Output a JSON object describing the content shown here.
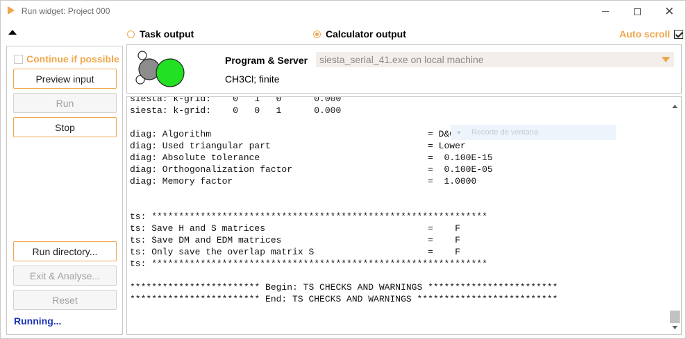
{
  "window": {
    "title": "Run widget: Project 000",
    "minimize_label": "",
    "maximize_label": "",
    "close_label": "✕"
  },
  "left_panel": {
    "continue_checkbox_label": "Continue if possible",
    "continue_checked": false,
    "buttons": [
      {
        "label": "Preview input",
        "enabled": true
      },
      {
        "label": "Run",
        "enabled": false
      },
      {
        "label": "Stop",
        "enabled": true
      },
      {
        "label": "Run directory...",
        "enabled": true
      },
      {
        "label": "Exit & Analyse...",
        "enabled": false
      },
      {
        "label": "Reset",
        "enabled": false
      }
    ],
    "status": "Running..."
  },
  "tabs": {
    "task_output": "Task output",
    "calculator_output": "Calculator output",
    "selected": "calculator_output",
    "auto_scroll": "Auto scroll",
    "auto_scroll_checked": true
  },
  "calculator": {
    "program_label": "Program & Server",
    "program_value": "siesta_serial_41.exe on local machine",
    "system": "CH3Cl; finite"
  },
  "output_lines": [
    "siesta: k-grid:    0   1   0      0.000",
    "siesta: k-grid:    0   0   1      0.000",
    "",
    "diag: Algorithm                                        = D&C",
    "diag: Used triangular part                             = Lower",
    "diag: Absolute tolerance                               =  0.100E-15",
    "diag: Orthogonalization factor                         =  0.100E-05",
    "diag: Memory factor                                    =  1.0000",
    "",
    "",
    "ts: **************************************************************",
    "ts: Save H and S matrices                              =    F",
    "ts: Save DM and EDM matrices                           =    F",
    "ts: Only save the overlap matrix S                     =    F",
    "ts: **************************************************************",
    "",
    "************************ Begin: TS CHECKS AND WARNINGS ************************",
    "************************ End: TS CHECKS AND WARNINGS **************************"
  ],
  "overlay": {
    "text": "Recorte de ventana"
  },
  "colors": {
    "accent": "#f0a64b",
    "running": "#1a32b8",
    "chlorine": "#22e022",
    "carbon": "#8c8c8c"
  }
}
